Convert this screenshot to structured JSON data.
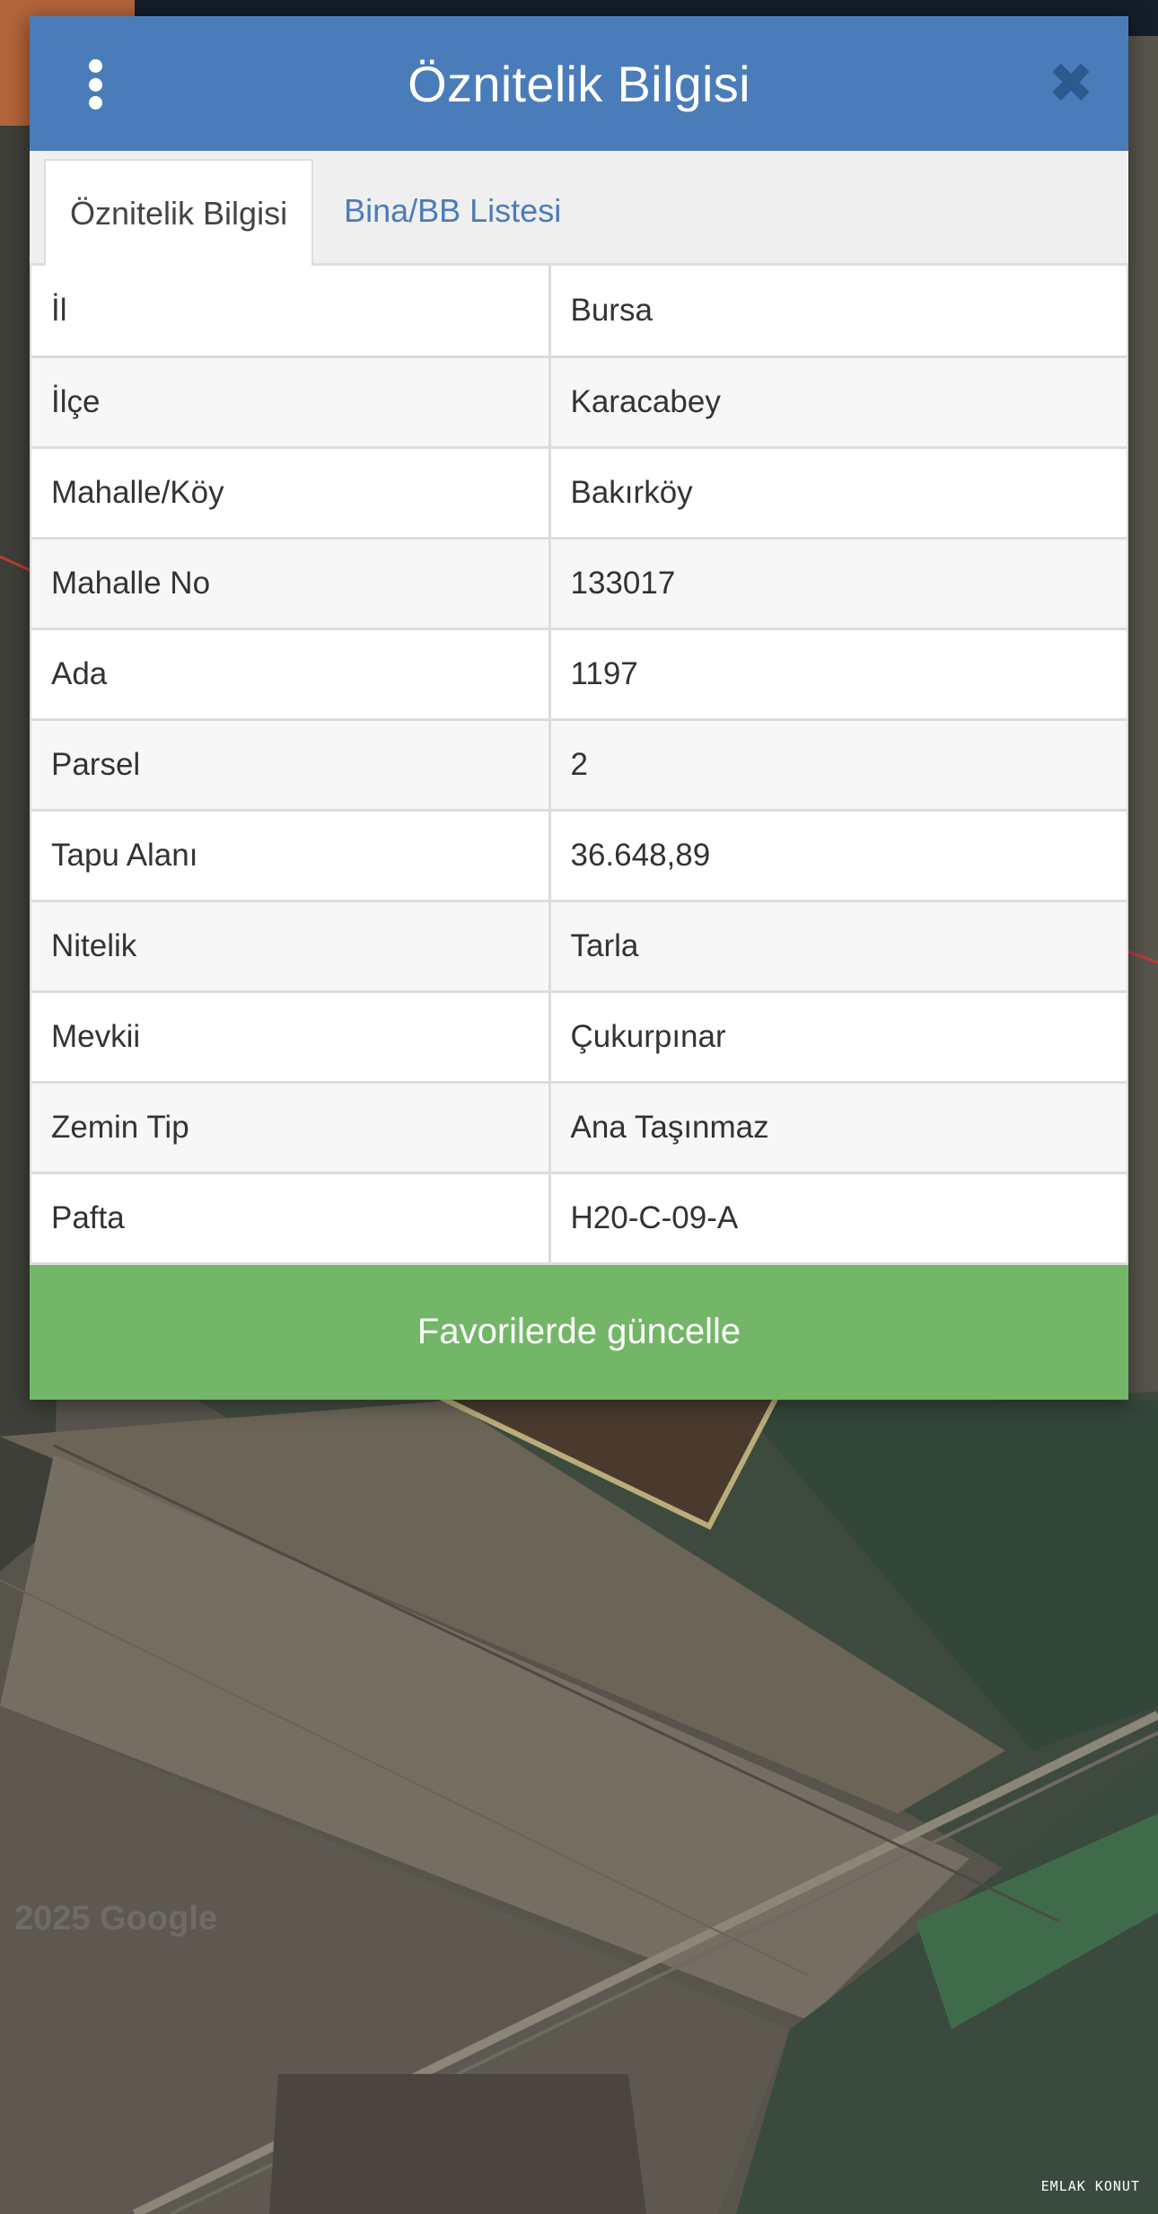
{
  "modal": {
    "title": "Öznitelik Bilgisi",
    "menu_icon": "vertical-ellipsis-icon",
    "close_icon": "close-icon",
    "close_symbol": "✖"
  },
  "tabs": [
    {
      "label": "Öznitelik Bilgisi",
      "active": true
    },
    {
      "label": "Bina/BB Listesi",
      "active": false
    }
  ],
  "attributes": [
    {
      "key": "İl",
      "value": "Bursa"
    },
    {
      "key": "İlçe",
      "value": "Karacabey"
    },
    {
      "key": "Mahalle/Köy",
      "value": "Bakırköy"
    },
    {
      "key": "Mahalle No",
      "value": "133017"
    },
    {
      "key": "Ada",
      "value": "1197"
    },
    {
      "key": "Parsel",
      "value": "2"
    },
    {
      "key": "Tapu Alanı",
      "value": "36.648,89"
    },
    {
      "key": "Nitelik",
      "value": "Tarla"
    },
    {
      "key": "Mevkii",
      "value": "Çukurpınar"
    },
    {
      "key": "Zemin Tip",
      "value": "Ana Taşınmaz"
    },
    {
      "key": "Pafta",
      "value": "H20-C-09-A"
    }
  ],
  "actions": {
    "update_favorites_label": "Favorilerde güncelle"
  },
  "map": {
    "attribution": "2025 Google",
    "watermark": "EMLAK KONUT"
  },
  "colors": {
    "header_blue": "#4a7cba",
    "close_blue": "#2c5a8f",
    "button_green": "#73b667"
  }
}
